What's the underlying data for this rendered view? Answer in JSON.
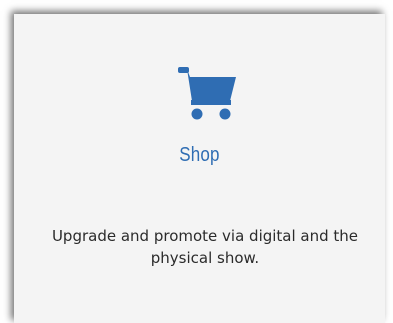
{
  "shop_card": {
    "icon": "shopping-cart-icon",
    "accent_color": "#2f6db3",
    "title": "Shop",
    "description": "Upgrade and promote via digital and the physical show."
  }
}
